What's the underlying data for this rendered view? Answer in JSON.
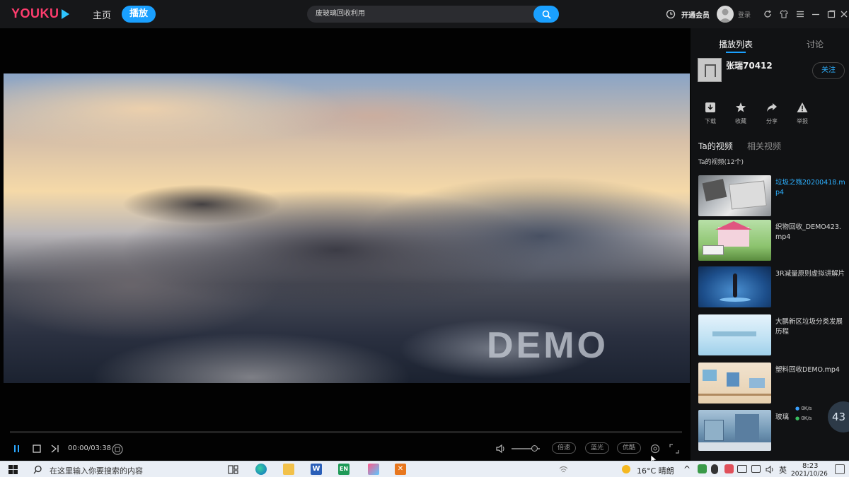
{
  "topbar": {
    "logo": "YOUKU",
    "nav_home": "主页",
    "nav_play": "播放",
    "search_value": "废玻璃回收利用",
    "vip_label": "开通会员",
    "login_label": "登录"
  },
  "player": {
    "watermark": "DEMO",
    "time": "00:00/03:38",
    "progress_fraction": 0.0,
    "volume_fraction": 0.8,
    "speed_label": "倍速",
    "quality_label": "蓝光",
    "enhance_label": "优酷"
  },
  "sidebar": {
    "tab_playlist": "播放列表",
    "tab_discuss": "讨论",
    "uploader_name": "张瑞70412",
    "follow_label": "关注",
    "actions": [
      {
        "label": "下载",
        "icon": "download-icon"
      },
      {
        "label": "收藏",
        "icon": "star-icon"
      },
      {
        "label": "分享",
        "icon": "share-icon"
      },
      {
        "label": "举报",
        "icon": "warning-icon"
      }
    ],
    "sub_tab_his": "Ta的视频",
    "sub_tab_related": "相关视频",
    "count_line": "Ta的视频(12个)",
    "videos": [
      {
        "title": "垃圾之殇20200418.mp4",
        "active": true
      },
      {
        "title": "织物回收_DEMO423.mp4",
        "active": false
      },
      {
        "title": "3R减量原则虚拟讲解片",
        "active": false
      },
      {
        "title": "大鹏新区垃圾分类发展历程",
        "active": false
      },
      {
        "title": "塑料回收DEMO.mp4",
        "active": false
      },
      {
        "title": "玻璃",
        "active": false
      }
    ],
    "speed_up": "0K/s",
    "speed_down": "0K/s",
    "circle_value": "43"
  },
  "taskbar": {
    "search_placeholder": "在这里输入你要搜索的内容",
    "weather": "16°C 晴朗",
    "ime": "英",
    "clock_time": "8:23",
    "clock_date": "2021/10/26"
  }
}
